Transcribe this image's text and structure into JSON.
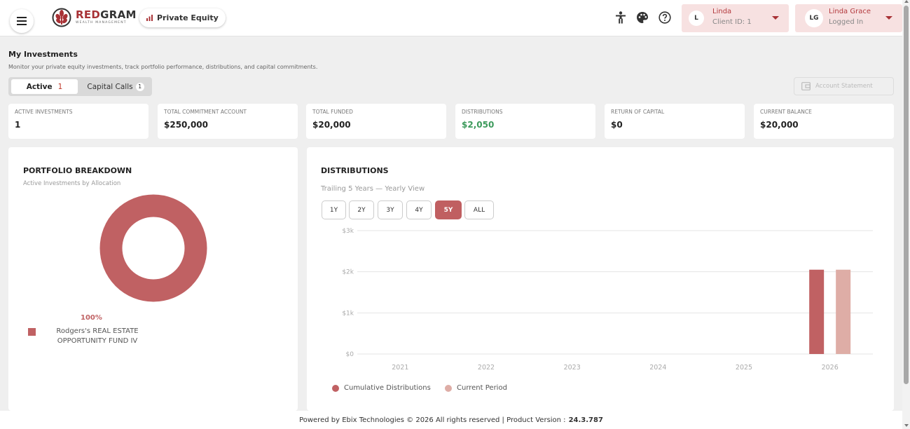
{
  "header": {
    "brand": "REDGRAM",
    "brand_sub": "WEALTH MANAGEMENT",
    "section_label": "Private Equity",
    "client": {
      "avatar": "L",
      "name": "Linda",
      "sub": "Client ID: 1"
    },
    "user": {
      "avatar": "LG",
      "name": "Linda Grace",
      "sub": "Logged In"
    },
    "icons": [
      "menu-icon",
      "accessibility-icon",
      "palette-icon",
      "help-icon",
      "bar-chart-icon"
    ]
  },
  "page": {
    "title": "My Investments",
    "subtitle": "Monitor your private equity investments, track portfolio performance, distributions, and capital commitments."
  },
  "tabs": [
    {
      "label": "Active",
      "count": "1"
    },
    {
      "label": "Capital Calls",
      "count": "1"
    }
  ],
  "account_statement_label": "Account Statement",
  "stats": [
    {
      "label": "Active Investments",
      "value": "1"
    },
    {
      "label": "Total Commitment Account",
      "value": "$250,000"
    },
    {
      "label": "Total Funded",
      "value": "$20,000"
    },
    {
      "label": "Distributions",
      "value": "$2,050"
    },
    {
      "label": "Return of Capital",
      "value": "$0"
    },
    {
      "label": "Current Balance",
      "value": "$20,000"
    }
  ],
  "portfolio": {
    "title": "PORTFOLIO BREAKDOWN",
    "subtitle": "Active Investments by Allocation",
    "percent_label": "100%",
    "legend_item": "Rodgers's REAL ESTATE OPPORTUNITY FUND IV",
    "color": "#c06163"
  },
  "distributions": {
    "title": "DISTRIBUTIONS",
    "subtitle": "Trailing 5 Years — Yearly View",
    "ranges": [
      "1Y",
      "2Y",
      "3Y",
      "4Y",
      "5Y",
      "ALL"
    ],
    "active_range": "5Y"
  },
  "chart_data": {
    "type": "bar",
    "categories": [
      "2021",
      "2022",
      "2023",
      "2024",
      "2025",
      "2026"
    ],
    "series": [
      {
        "name": "Cumulative Distributions",
        "color": "#c06163",
        "values": [
          0,
          0,
          0,
          0,
          0,
          2050
        ]
      },
      {
        "name": "Current Period",
        "color": "#deada6",
        "values": [
          0,
          0,
          0,
          0,
          0,
          2050
        ]
      }
    ],
    "yticks": [
      "$0",
      "$1k",
      "$2k",
      "$3k"
    ],
    "ylim": [
      0,
      3000
    ],
    "grid": true,
    "legend_position": "bottom-left"
  },
  "footer": {
    "text": "Powered by Ebix Technologies © 2026 All rights reserved | Product Version :",
    "version": "24.3.787"
  }
}
